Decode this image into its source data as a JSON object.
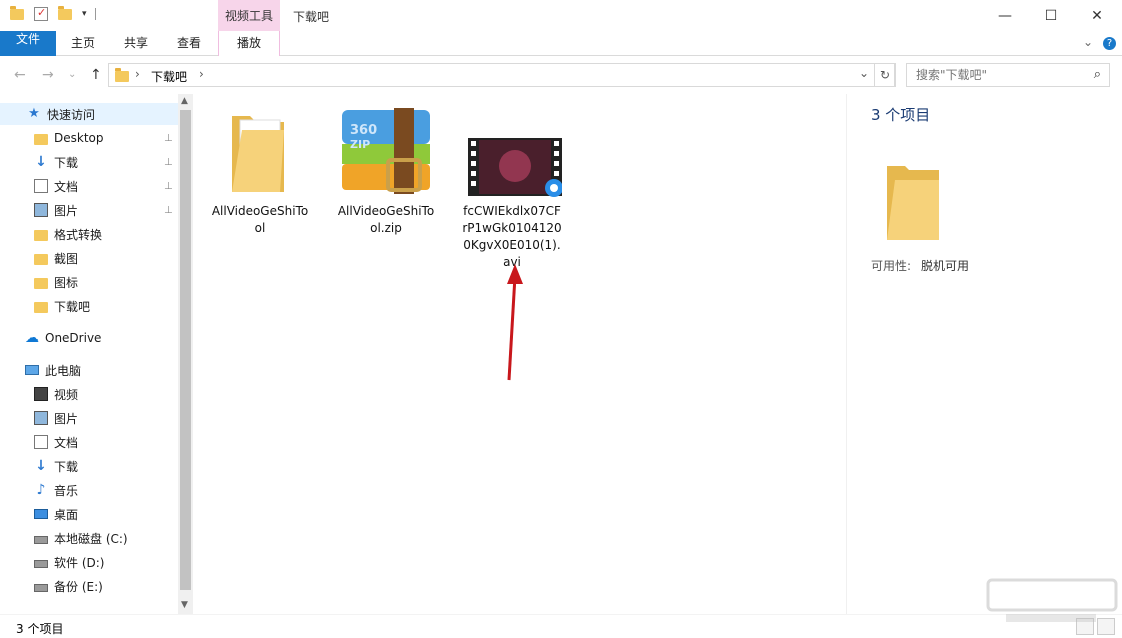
{
  "titlebar": {
    "context_tab": "视频工具",
    "window_title": "下载吧",
    "minimize": "—",
    "maximize": "☐",
    "close": "✕"
  },
  "ribbon": {
    "tabs": [
      "文件",
      "主页",
      "共享",
      "查看",
      "播放"
    ],
    "expand_chevron": "⌄",
    "help": "?"
  },
  "nav": {
    "back": "←",
    "forward": "→",
    "recent": "⌄",
    "up": "↑",
    "address_sep1": "›",
    "address_crumb": "下载吧",
    "address_sep2": "›",
    "address_dropdown": "⌄",
    "refresh": "↻",
    "search_placeholder": "搜索\"下载吧\"",
    "search_icon": "⌕"
  },
  "sidebar": {
    "items": [
      {
        "label": "快速访问",
        "icon": "star-icon"
      },
      {
        "label": "Desktop",
        "icon": "folder-icon",
        "pinned": true
      },
      {
        "label": "下载",
        "icon": "download-icon",
        "pinned": true
      },
      {
        "label": "文档",
        "icon": "document-icon",
        "pinned": true
      },
      {
        "label": "图片",
        "icon": "picture-icon",
        "pinned": true
      },
      {
        "label": "格式转换",
        "icon": "folder-icon"
      },
      {
        "label": "截图",
        "icon": "folder-icon"
      },
      {
        "label": "图标",
        "icon": "folder-icon"
      },
      {
        "label": "下载吧",
        "icon": "folder-icon"
      },
      {
        "label": "OneDrive",
        "icon": "cloud-icon"
      },
      {
        "label": "此电脑",
        "icon": "computer-icon"
      },
      {
        "label": "视频",
        "icon": "video-icon"
      },
      {
        "label": "图片",
        "icon": "picture-icon"
      },
      {
        "label": "文档",
        "icon": "document-icon"
      },
      {
        "label": "下载",
        "icon": "download-icon"
      },
      {
        "label": "音乐",
        "icon": "music-icon"
      },
      {
        "label": "桌面",
        "icon": "desktop-icon"
      },
      {
        "label": "本地磁盘 (C:)",
        "icon": "drive-icon"
      },
      {
        "label": "软件 (D:)",
        "icon": "drive-icon"
      },
      {
        "label": "备份 (E:)",
        "icon": "drive-icon"
      }
    ],
    "pin_glyph": "📌"
  },
  "files": [
    {
      "name": "AllVideoGeShiTool",
      "type": "folder"
    },
    {
      "name": "AllVideoGeShiTool.zip",
      "type": "zip"
    },
    {
      "name": "fcCWIEkdlx07CFrP1wGk01041200KgvX0E010(1).avi",
      "type": "video"
    }
  ],
  "details": {
    "count": "3 个项目",
    "availability_label": "可用性:",
    "availability_value": "脱机可用"
  },
  "status": {
    "text": "3 个项目"
  },
  "colors": {
    "file_tab": "#1979ca",
    "context_tab": "#f7d5ea",
    "folder": "#f4c95d",
    "arrow": "#c8171c"
  }
}
